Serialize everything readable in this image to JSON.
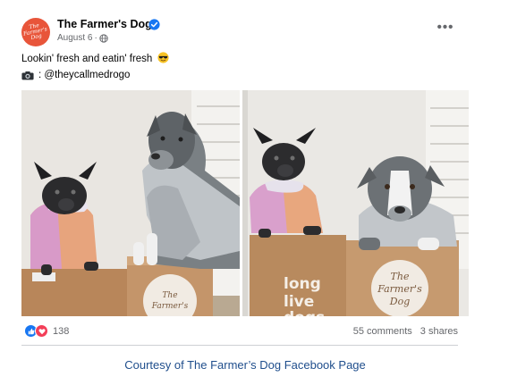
{
  "post": {
    "page_name": "The Farmer's Dog",
    "date": "August 6",
    "date_separator": "·",
    "logo_text": "The\nFarmer's\nDog",
    "caption": "Lookin' fresh and eatin' fresh",
    "credit_handle": ": @theycallmedrogo",
    "more_label": "•••",
    "reaction_count": "138",
    "comments": "55 comments",
    "shares": "3 shares"
  },
  "photos": {
    "box_label_left_1": "The\nFarmer's",
    "box_label_right_1": "long\nlive\ndogs",
    "box_label_right_2": "The\nFarmer's\nDog"
  },
  "footer": {
    "courtesy": "Courtesy of The Farmer’s Dog Facebook Page"
  },
  "colors": {
    "brand": "#e8553a",
    "verified": "#1877f2",
    "like": "#1877f2",
    "love": "#f33e58",
    "link": "#1f4e8c"
  },
  "icons": {
    "verified": "verified-badge-icon",
    "globe": "globe-icon",
    "camera": "camera-icon",
    "sunglasses": "sunglasses-emoji-icon",
    "like": "like-icon",
    "love": "love-icon"
  }
}
